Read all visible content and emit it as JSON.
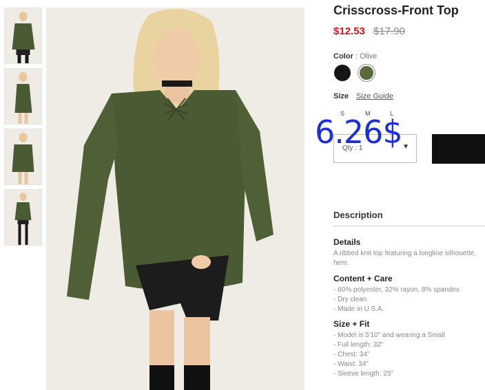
{
  "product": {
    "title": "Crisscross-Front Top",
    "price": "$12.53",
    "original_price": "$17.90"
  },
  "color": {
    "label": "Color",
    "value": ": Olive",
    "swatches": [
      {
        "name": "Black",
        "hex": "#151515"
      },
      {
        "name": "Olive",
        "hex": "#5a6a3c"
      }
    ]
  },
  "size": {
    "label": "Size",
    "guide": "Size Guide",
    "options": [
      "S",
      "M",
      "L"
    ]
  },
  "quantity": {
    "placeholder": "Qty : 1",
    "caret": "▼"
  },
  "overlay_text": "6.26$",
  "description": {
    "heading": "Description",
    "details_title": "Details",
    "details_lines": [
      "A ribbed knit top featuring a longline silhouette,",
      "hem."
    ],
    "care_title": "Content + Care",
    "care_lines": [
      "- 60% polyester, 32% rayon, 8% spandex",
      "- Dry clean",
      "- Made in U.S.A."
    ],
    "fit_title": "Size + Fit",
    "fit_lines": [
      "- Model is 5'10\" and wearing a Small",
      "- Full length: 32\"",
      "- Chest: 34\"",
      "- Waist: 34\"",
      "- Sleeve length: 25\""
    ]
  },
  "colors": {
    "price_red": "#d5131b",
    "olive": "#4a5a33",
    "overlay_blue": "#1a2fd6"
  }
}
